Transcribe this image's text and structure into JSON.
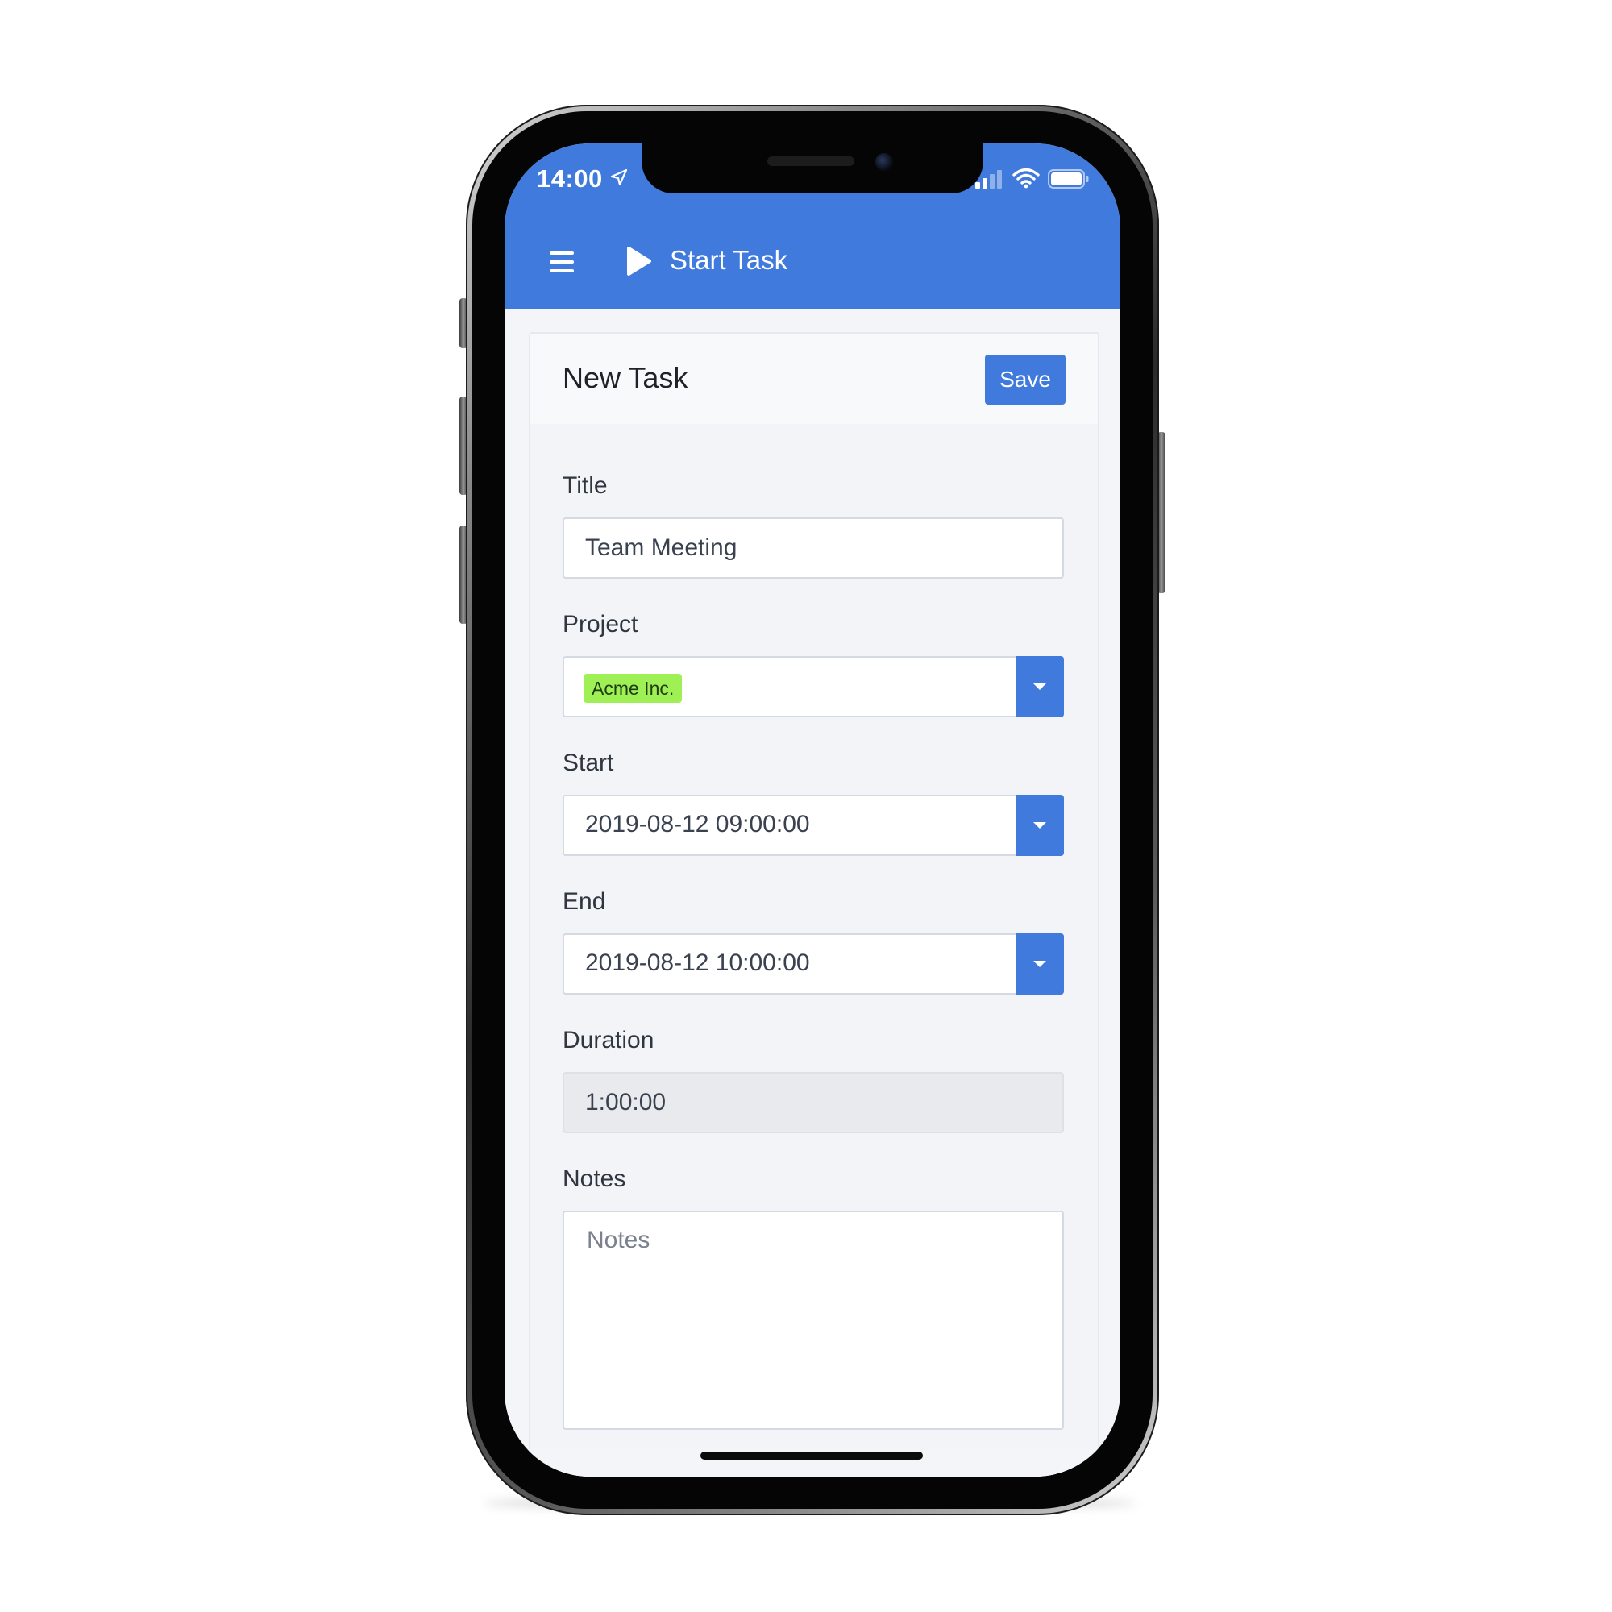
{
  "status_bar": {
    "time": "14:00",
    "location_icon": "location-arrow-icon",
    "signal_icon": "cellular-signal-icon",
    "wifi_icon": "wifi-icon",
    "battery_icon": "battery-icon"
  },
  "appbar": {
    "menu_icon": "hamburger-menu-icon",
    "play_icon": "play-icon",
    "title": "Start Task",
    "color": "#3f7adc"
  },
  "card": {
    "title": "New Task",
    "save_label": "Save"
  },
  "form": {
    "title": {
      "label": "Title",
      "value": "Team Meeting"
    },
    "project": {
      "label": "Project",
      "value": "Acme Inc.",
      "tag_color": "#9ef055"
    },
    "start": {
      "label": "Start",
      "value": "2019-08-12 09:00:00"
    },
    "end": {
      "label": "End",
      "value": "2019-08-12 10:00:00"
    },
    "duration": {
      "label": "Duration",
      "value": "1:00:00"
    },
    "notes": {
      "label": "Notes",
      "placeholder": "Notes",
      "value": ""
    }
  }
}
